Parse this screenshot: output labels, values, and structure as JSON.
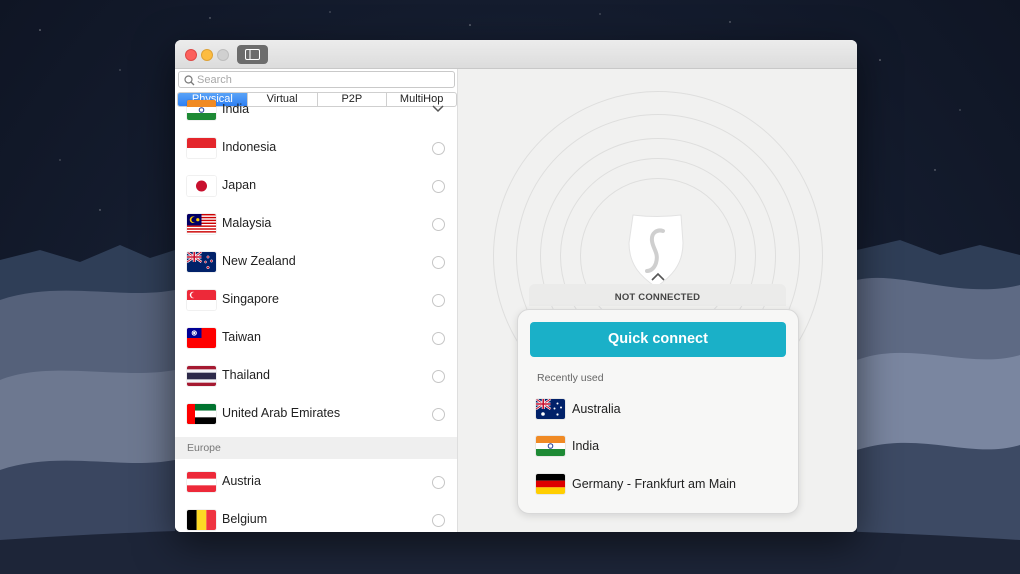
{
  "search": {
    "placeholder": "Search"
  },
  "tabs": [
    {
      "label": "Physical",
      "active": true
    },
    {
      "label": "Virtual",
      "active": false
    },
    {
      "label": "P2P",
      "active": false
    },
    {
      "label": "MultiHop",
      "active": false
    }
  ],
  "countries": [
    {
      "name": "India",
      "flag": "india-flag-icon",
      "expanded": true
    },
    {
      "name": "Indonesia",
      "flag": "indonesia-flag-icon"
    },
    {
      "name": "Japan",
      "flag": "japan-flag-icon"
    },
    {
      "name": "Malaysia",
      "flag": "malaysia-flag-icon"
    },
    {
      "name": "New Zealand",
      "flag": "new-zealand-flag-icon"
    },
    {
      "name": "Singapore",
      "flag": "singapore-flag-icon"
    },
    {
      "name": "Taiwan",
      "flag": "taiwan-flag-icon"
    },
    {
      "name": "Thailand",
      "flag": "thailand-flag-icon"
    },
    {
      "name": "United Arab Emirates",
      "flag": "uae-flag-icon"
    }
  ],
  "europe": {
    "header": "Europe",
    "countries": [
      {
        "name": "Austria",
        "flag": "austria-flag-icon"
      },
      {
        "name": "Belgium",
        "flag": "belgium-flag-icon"
      }
    ]
  },
  "connection": {
    "status": "NOT CONNECTED",
    "quick_connect_label": "Quick connect",
    "recently_used_label": "Recently used",
    "recent": [
      {
        "name": "Australia",
        "flag": "australia-flag-icon"
      },
      {
        "name": "India",
        "flag": "india-flag-icon"
      },
      {
        "name": "Germany - Frankfurt am Main",
        "flag": "germany-flag-icon"
      }
    ]
  },
  "colors": {
    "accent": "#1ab0c8",
    "tab_active": "#2d7ff3"
  }
}
